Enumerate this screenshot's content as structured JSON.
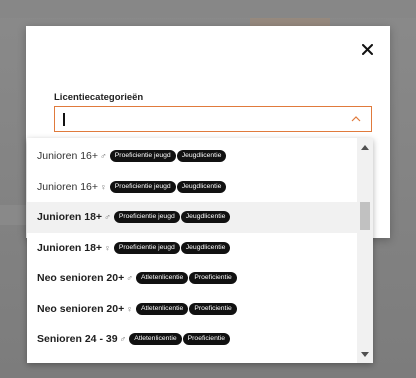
{
  "colors": {
    "accent": "#e07a3c",
    "badge": "#111111",
    "highlight": "#f1f1f1"
  },
  "modal": {
    "close_icon": "close-icon",
    "field": {
      "label": "Licentiecategorieën",
      "value": "",
      "chevron_icon": "chevron-up-icon"
    }
  },
  "dropdown": {
    "options": [
      {
        "name": "Junioren 16+",
        "gender": "♂",
        "badges": [
          "Proeficientie jeugd",
          "Jeugdlicentie"
        ],
        "style": "light"
      },
      {
        "name": "Junioren 16+",
        "gender": "♀",
        "badges": [
          "Proeficientie jeugd",
          "Jeugdlicentie"
        ],
        "style": "light"
      },
      {
        "name": "Junioren 18+",
        "gender": "♂",
        "badges": [
          "Proeficientie jeugd",
          "Jeugdlicentie"
        ],
        "style": "bold",
        "highlighted": true
      },
      {
        "name": "Junioren 18+",
        "gender": "♀",
        "badges": [
          "Proeficientie jeugd",
          "Jeugdlicentie"
        ],
        "style": "bold"
      },
      {
        "name": "Neo senioren 20+",
        "gender": "♂",
        "badges": [
          "Atletenlicentie",
          "Proeficientie"
        ],
        "style": "bold"
      },
      {
        "name": "Neo senioren 20+",
        "gender": "♀",
        "badges": [
          "Atletenlicentie",
          "Proeficientie"
        ],
        "style": "bold"
      },
      {
        "name": "Senioren 24 - 39",
        "gender": "♂",
        "badges": [
          "Atletenlicentie",
          "Proeficientie"
        ],
        "style": "bold"
      }
    ]
  }
}
